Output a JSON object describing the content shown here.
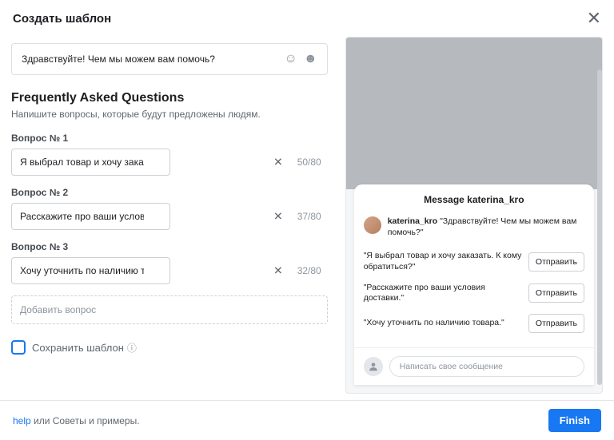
{
  "header": {
    "title": "Создать шаблон"
  },
  "greeting": {
    "text": "Здравствуйте! Чем мы можем вам помочь?"
  },
  "faq": {
    "heading": "Frequently Asked Questions",
    "subheading": "Напишите вопросы, которые будут предложены людям.",
    "questions": [
      {
        "label": "Вопрос № 1",
        "value": "Я выбрал товар и хочу заказать. К кому обратиться?",
        "counter": "50/80"
      },
      {
        "label": "Вопрос № 2",
        "value": "Расскажите про ваши условия доставки.",
        "counter": "37/80"
      },
      {
        "label": "Вопрос № 3",
        "value": "Хочу уточнить по наличию товара.",
        "counter": "32/80"
      }
    ],
    "add_label": "Добавить вопрос"
  },
  "save": {
    "label": "Сохранить шаблон"
  },
  "preview": {
    "title": "Message katerina_kro",
    "username": "katerina_kro",
    "greeting": "\"Здравствуйте! Чем мы можем вам помочь?\"",
    "items": [
      {
        "text": "\"Я выбрал товар и хочу заказать. К кому обратиться?\"",
        "button": "Отправить"
      },
      {
        "text": "\"Расскажите про ваши условия доставки.\"",
        "button": "Отправить"
      },
      {
        "text": "\"Хочу уточнить по наличию товара.\"",
        "button": "Отправить"
      }
    ],
    "input_placeholder": "Написать свое сообщение"
  },
  "footer": {
    "help": "help",
    "or_text": " или Советы и примеры.",
    "finish": "Finish"
  }
}
